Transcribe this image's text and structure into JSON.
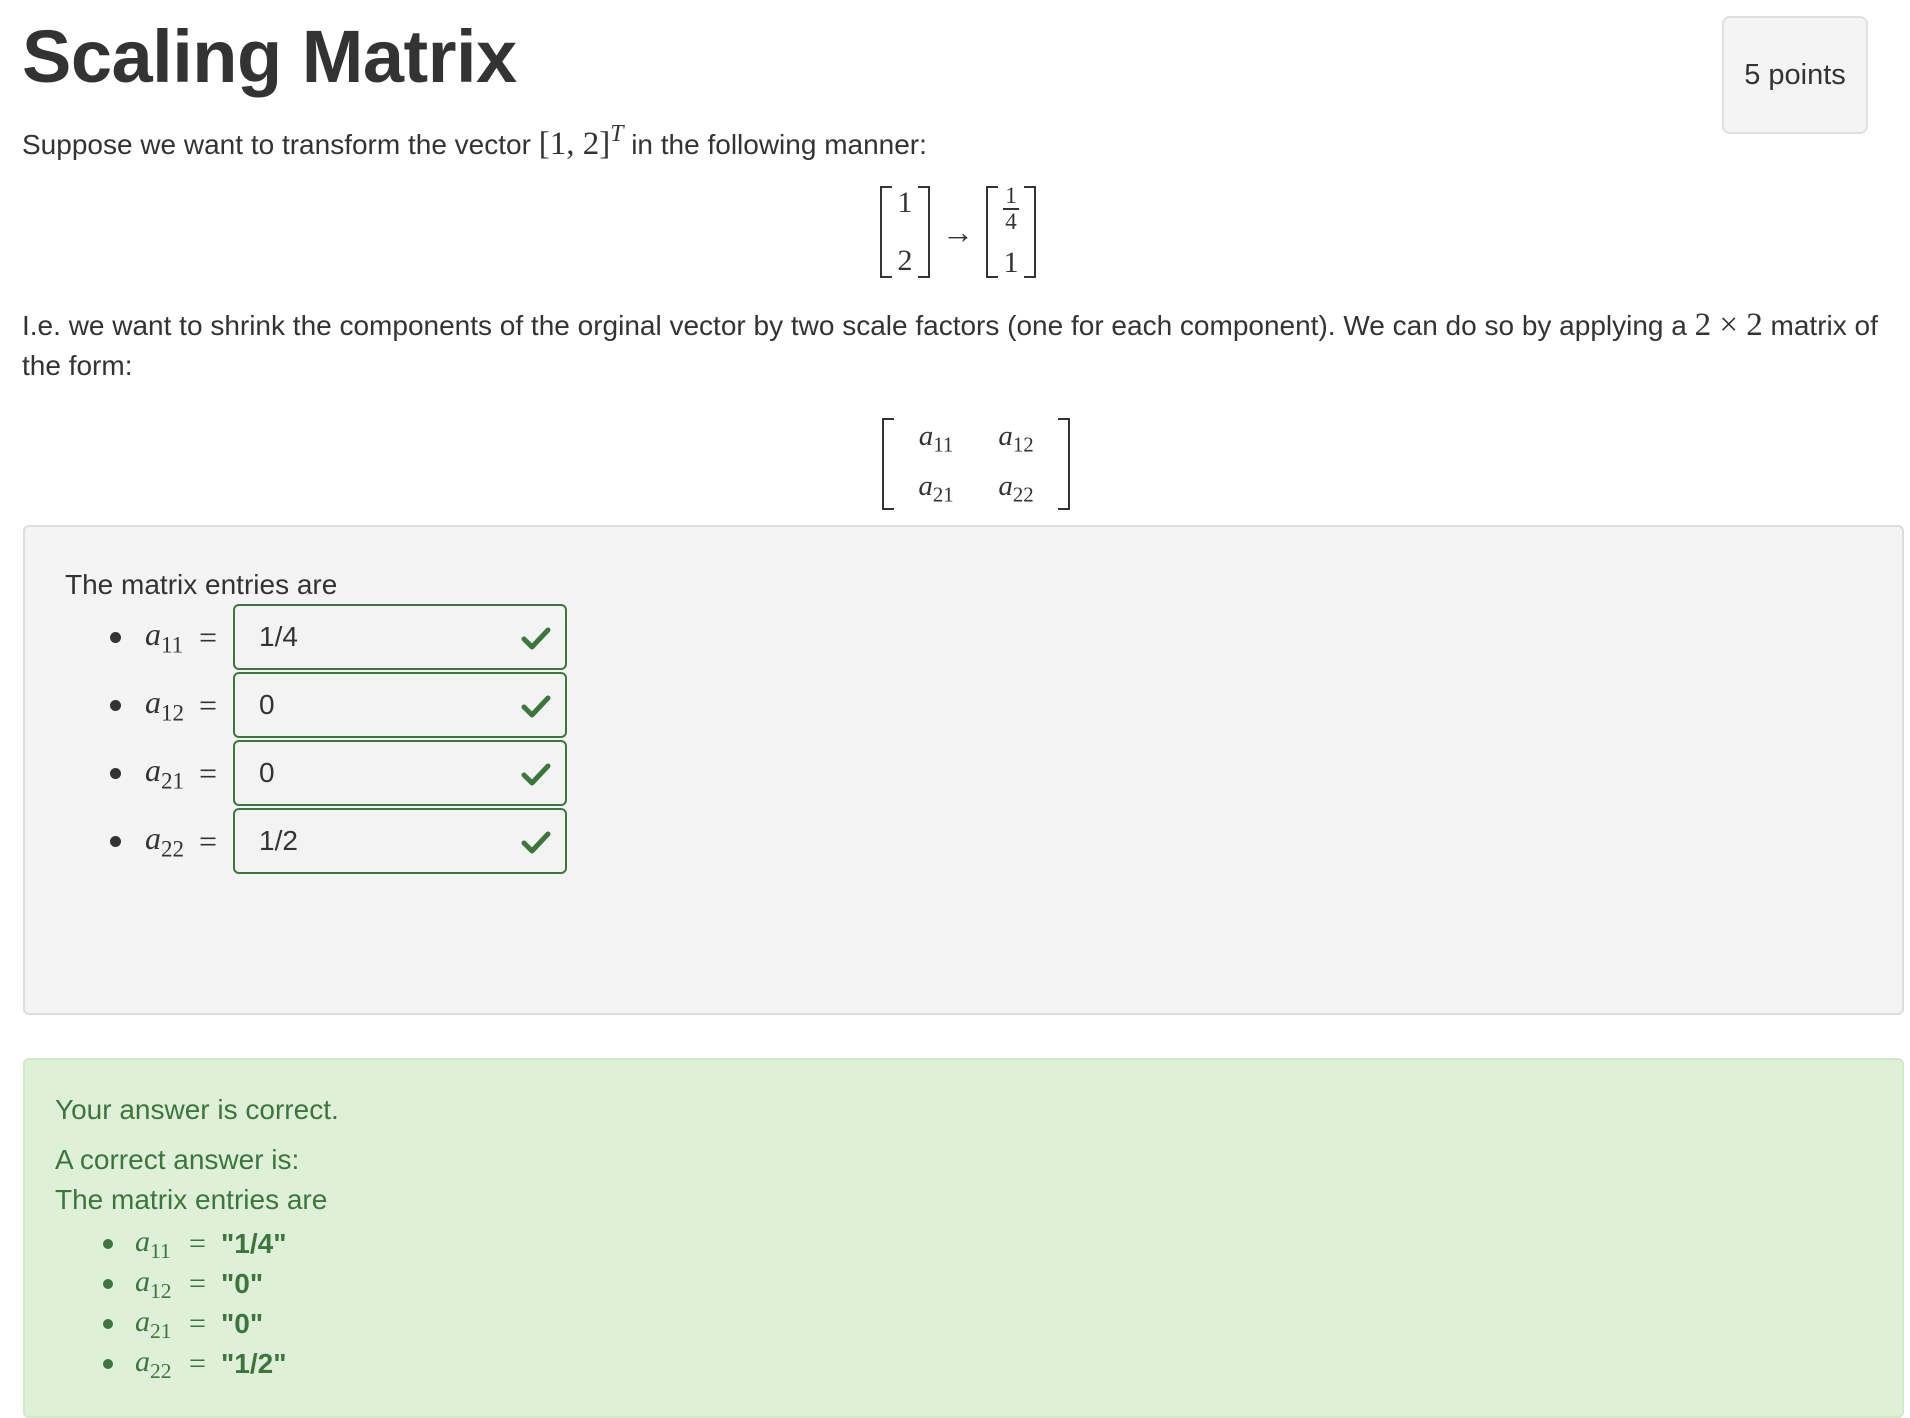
{
  "title": "Scaling Matrix",
  "points": "5 points",
  "intro": {
    "before": "Suppose we want to transform the vector",
    "vector": "[1, 2]",
    "transpose": "T",
    "after": "in the following manner:"
  },
  "transform": {
    "left": [
      "1",
      "2"
    ],
    "arrow": "→",
    "right_top_num": "1",
    "right_top_den": "4",
    "right_bottom": "1"
  },
  "explanation": {
    "before": "I.e. we want to shrink the components of the orginal vector by two scale factors (one for each component). We can do so by applying a",
    "size": "2 × 2",
    "after": "matrix of the form:"
  },
  "matrix_form": {
    "a11": {
      "base": "a",
      "sub": "11"
    },
    "a12": {
      "base": "a",
      "sub": "12"
    },
    "a21": {
      "base": "a",
      "sub": "21"
    },
    "a22": {
      "base": "a",
      "sub": "22"
    }
  },
  "question": {
    "intro": "The matrix entries are",
    "equals": "=",
    "entries": [
      {
        "base": "a",
        "sub": "11",
        "value": "1/4",
        "status": "correct"
      },
      {
        "base": "a",
        "sub": "12",
        "value": "0",
        "status": "correct"
      },
      {
        "base": "a",
        "sub": "21",
        "value": "0",
        "status": "correct"
      },
      {
        "base": "a",
        "sub": "22",
        "value": "1/2",
        "status": "correct"
      }
    ],
    "check_icon": "check-icon",
    "correct_color": "#3c763d"
  },
  "feedback": {
    "result": "Your answer is correct.",
    "correct_label": "A correct answer is:",
    "intro": "The matrix entries are",
    "equals": "=",
    "entries": [
      {
        "base": "a",
        "sub": "11",
        "value": "\"1/4\""
      },
      {
        "base": "a",
        "sub": "12",
        "value": "\"0\""
      },
      {
        "base": "a",
        "sub": "21",
        "value": "\"0\""
      },
      {
        "base": "a",
        "sub": "22",
        "value": "\"1/2\""
      }
    ],
    "background": "#dff0d8",
    "text_color": "#3c763d"
  }
}
